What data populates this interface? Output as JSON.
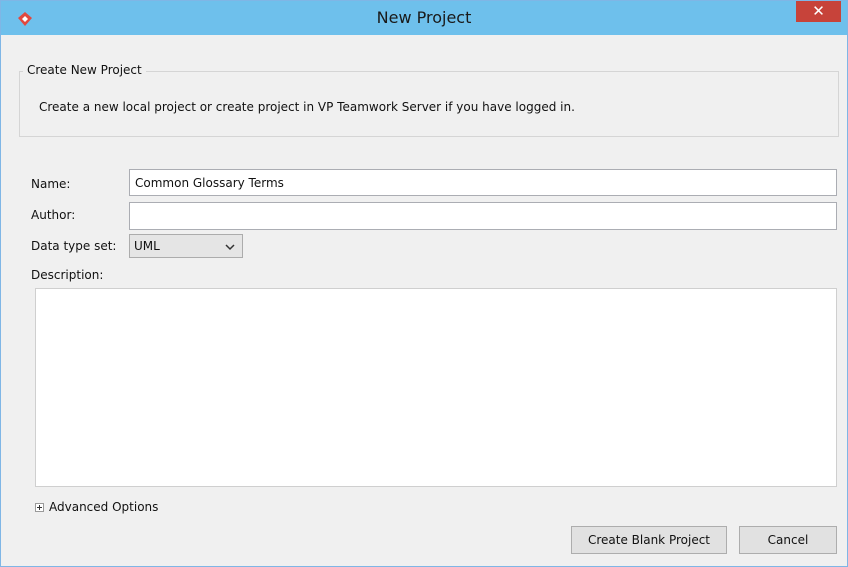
{
  "window": {
    "title": "New Project",
    "close_glyph": "✕"
  },
  "group": {
    "legend": "Create New Project",
    "message": "Create a new local project or create project in VP Teamwork Server if you have logged in."
  },
  "form": {
    "name_label": "Name:",
    "name_value": "Common Glossary Terms",
    "author_label": "Author:",
    "author_value": "",
    "data_type_label": "Data type set:",
    "data_type_value": "UML",
    "description_label": "Description:",
    "description_value": ""
  },
  "advanced": {
    "label": "Advanced Options"
  },
  "buttons": {
    "create": "Create Blank Project",
    "cancel": "Cancel"
  },
  "colors": {
    "titlebar": "#6ec0ec",
    "close": "#c7433a",
    "app_icon": "#e2483f"
  }
}
